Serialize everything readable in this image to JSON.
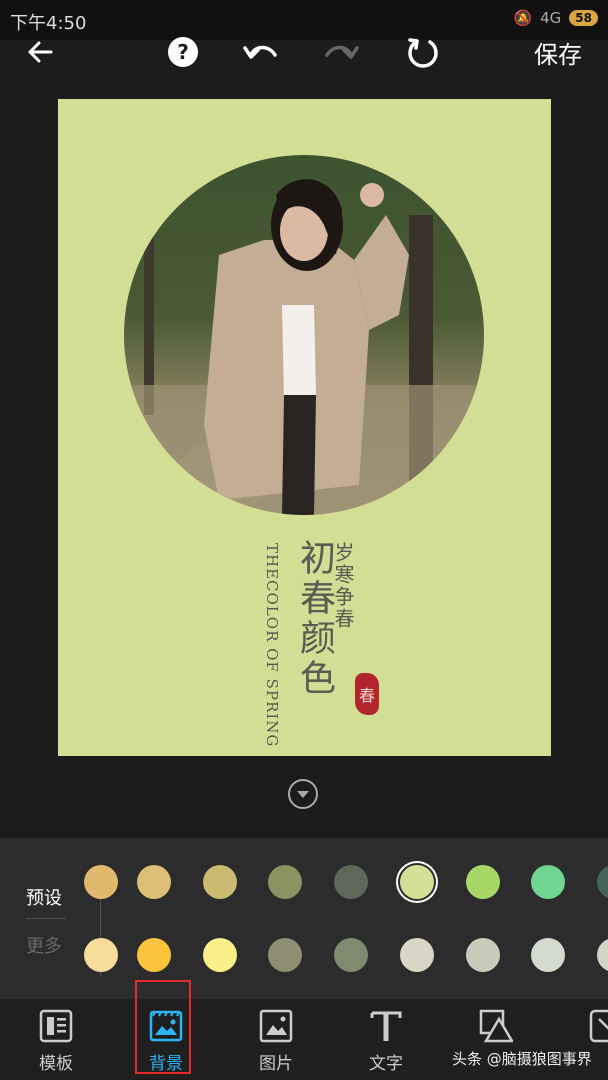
{
  "status_bar": {
    "time": "下午4:50",
    "network": "4G",
    "battery": "58"
  },
  "toolbar": {
    "save_label": "保存"
  },
  "poster": {
    "bg_color": "#d3de95",
    "title": "初春颜色",
    "subtitle": "岁寒争春",
    "english": "THECOLOR OF SPRING",
    "seal_char": "春"
  },
  "panel": {
    "tab_preset": "预设",
    "tab_more": "更多",
    "swatches_row1": [
      "#e2b86f",
      "#dcbf75",
      "#cabb71",
      "#8c9262",
      "#5f6858",
      "#d6df98",
      "#a7d866",
      "#6fd591",
      "#45655c"
    ],
    "swatches_row2": [
      "#f7dc9c",
      "#f9c33c",
      "#f9f08a",
      "#8e8e73",
      "#7f8b6f",
      "#d9d6c6",
      "#c9cbb8",
      "#d5dacf",
      "#d0d5c6"
    ],
    "selected_color": "#d6df98"
  },
  "nav": {
    "template": "模板",
    "background": "背景",
    "image": "图片",
    "text": "文字"
  },
  "watermark": "头条 @脑摄狼图事界"
}
